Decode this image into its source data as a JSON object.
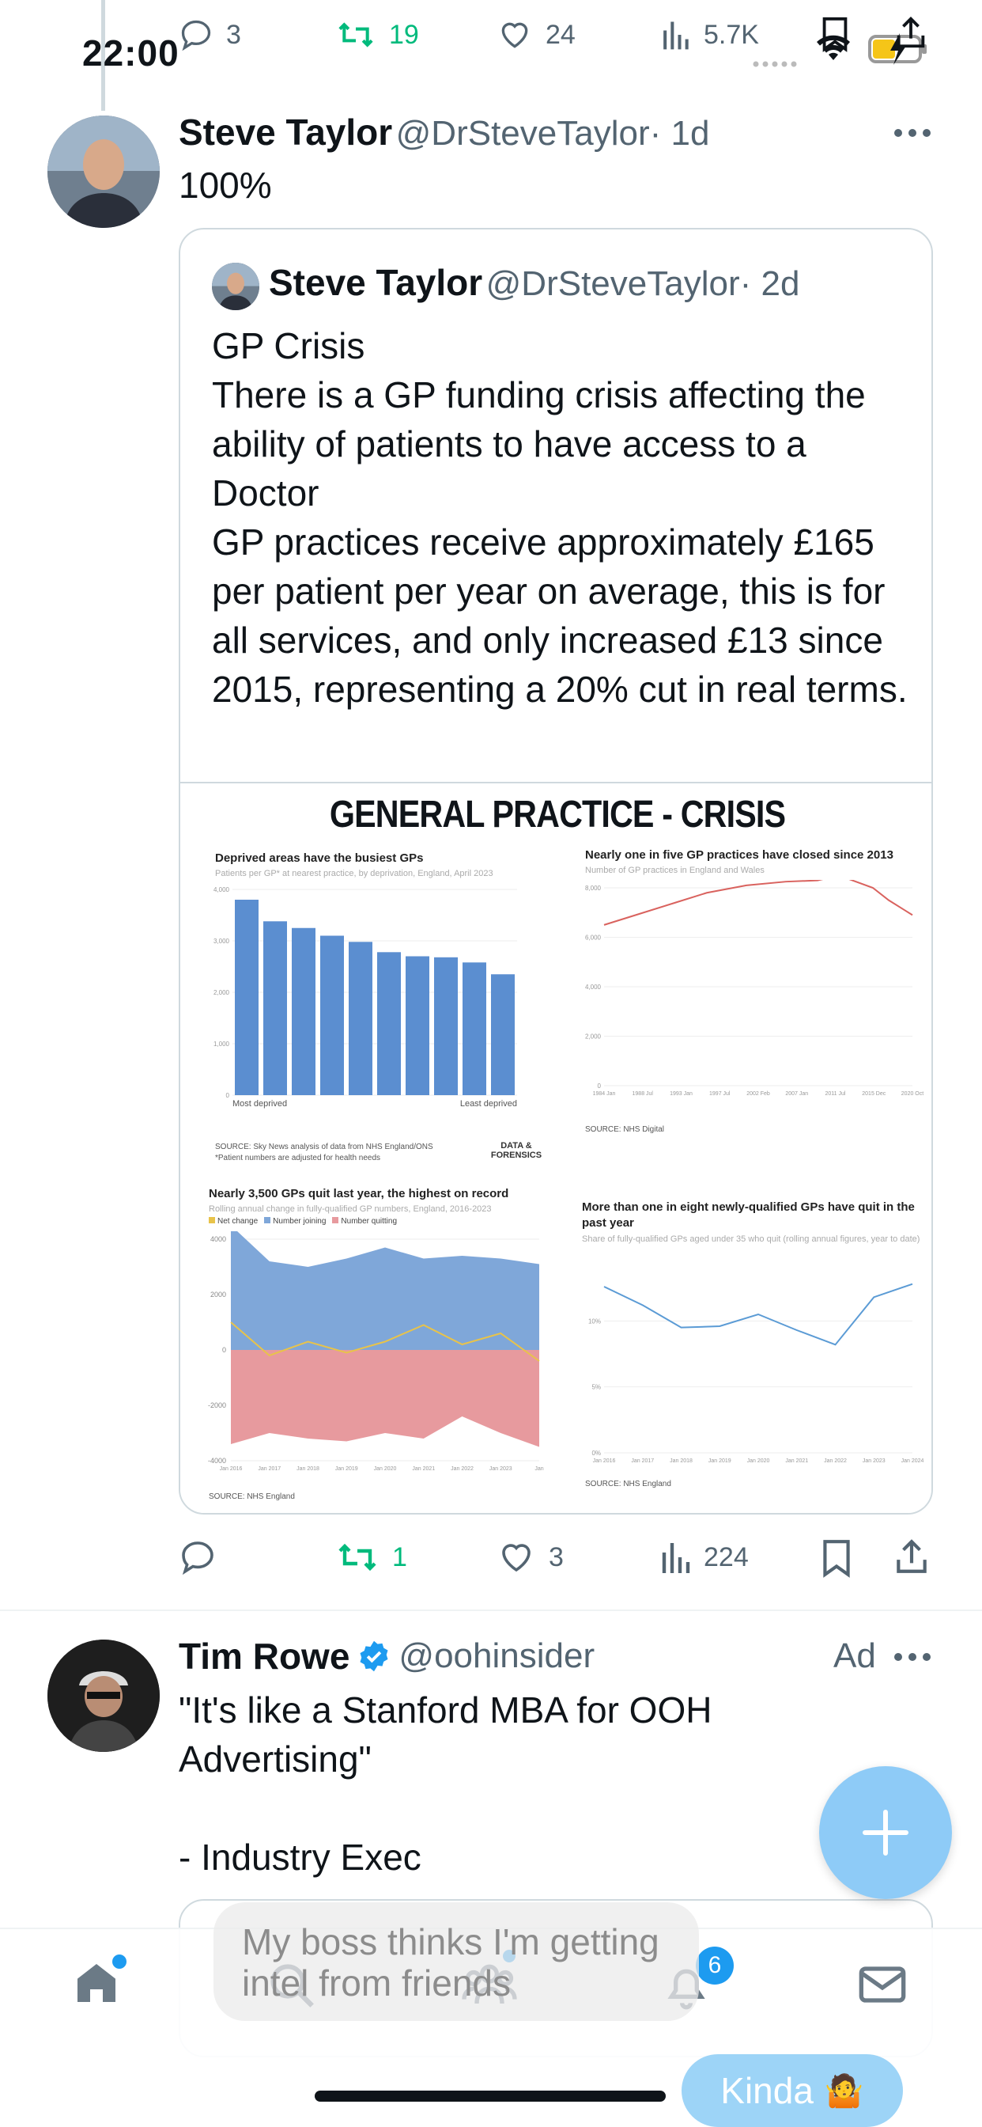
{
  "status_bar": {
    "time": "22:00"
  },
  "top_actions": {
    "replies": "3",
    "retweets": "19",
    "likes": "24",
    "views": "5.7K"
  },
  "tweet": {
    "author_name": "Steve Taylor",
    "author_handle": "@DrSteveTaylor",
    "age": "· 1d",
    "text": "100%",
    "quote": {
      "author_name": "Steve Taylor",
      "author_handle": "@DrSteveTaylor",
      "age": "· 2d",
      "text": "GP Crisis\nThere is a GP funding crisis affecting the ability of patients to have access to a Doctor\nGP practices receive approximately £165 per patient per year on average, this is for all services, and only increased £13 since 2015, representing a 20% cut in real terms."
    },
    "actions": {
      "replies": "",
      "retweets": "1",
      "likes": "3",
      "views": "224"
    }
  },
  "infographic": {
    "title": "GENERAL PRACTICE - CRISIS",
    "brand": "DATA &\nFORENSICS"
  },
  "chart_data": [
    {
      "type": "bar",
      "title": "Deprived areas have the busiest GPs",
      "subtitle": "Patients per GP* at nearest practice, by deprivation, England, April 2023",
      "categories": [
        "Most deprived",
        "",
        "",
        "",
        "",
        "",
        "",
        "",
        "",
        "Least deprived"
      ],
      "values": [
        3800,
        3380,
        3250,
        3100,
        2980,
        2780,
        2700,
        2680,
        2580,
        2350
      ],
      "ylim": [
        0,
        4000
      ],
      "yticks": [
        "0",
        "1,000",
        "2,000",
        "3,000",
        "4,000"
      ],
      "source": "SOURCE: Sky News analysis of data from NHS England/ONS",
      "note": "*Patient numbers are adjusted for health needs",
      "color": "#5b8ed0"
    },
    {
      "type": "line",
      "title": "Nearly one in five GP practices have closed since 2013",
      "subtitle": "Number of GP practices in England and Wales",
      "x": [
        1984,
        1988,
        1993,
        1997,
        2002,
        2007,
        2011,
        2013,
        2015,
        2018,
        2020,
        2023
      ],
      "values": [
        6500,
        6900,
        7400,
        7800,
        8100,
        8250,
        8300,
        8450,
        8350,
        8000,
        7500,
        6900
      ],
      "xticks": [
        "1984 Jan",
        "1988 Jul",
        "1993 Jan",
        "1997 Jul",
        "2002 Feb",
        "2007 Jan",
        "2011 Jul",
        "2015 Dec",
        "2020 Oct"
      ],
      "ylim": [
        0,
        8000
      ],
      "yticks": [
        "0",
        "2,000",
        "4,000",
        "6,000",
        "8,000"
      ],
      "source": "SOURCE: NHS Digital",
      "color": "#d9625e"
    },
    {
      "type": "area",
      "title": "Nearly 3,500 GPs quit last year, the highest on record",
      "subtitle": "Rolling annual change in fully-qualified GP numbers, England, 2016-2023",
      "legend": [
        "Net change",
        "Number joining",
        "Number quitting"
      ],
      "x": [
        "Jan 2016",
        "Jan 2017",
        "Jan 2018",
        "Jan 2019",
        "Jan 2020",
        "Jan 2021",
        "Jan 2022",
        "Jan 2023",
        "Jan"
      ],
      "series": [
        {
          "name": "Number joining",
          "values": [
            4500,
            3200,
            3000,
            3300,
            3700,
            3300,
            3400,
            3300,
            3100
          ],
          "color": "#7fa7d9"
        },
        {
          "name": "Number quitting",
          "values": [
            -3400,
            -3000,
            -3200,
            -3300,
            -3000,
            -3200,
            -2400,
            -3000,
            -3500
          ],
          "color": "#e79a9e"
        },
        {
          "name": "Net change",
          "values": [
            1000,
            -200,
            300,
            -100,
            300,
            900,
            200,
            600,
            -400
          ],
          "color": "#e8c34a"
        }
      ],
      "ylim": [
        -4000,
        4000
      ],
      "yticks": [
        "-4000",
        "-2000",
        "0",
        "2000",
        "4000"
      ],
      "source": "SOURCE: NHS England"
    },
    {
      "type": "line",
      "title": "More than one in eight newly-qualified GPs have quit in the past year",
      "subtitle": "Share of fully-qualified GPs aged under 35 who quit (rolling annual figures, year to date)",
      "x": [
        "Jan 2016",
        "Jan 2017",
        "Jan 2018",
        "Jan 2019",
        "Jan 2020",
        "Jan 2021",
        "Jan 2022",
        "Jan 2023",
        "Jan 2024"
      ],
      "values": [
        12.6,
        11.2,
        9.5,
        9.6,
        10.5,
        9.3,
        8.2,
        11.8,
        12.8
      ],
      "ylim": [
        0,
        15
      ],
      "yticks": [
        "0%",
        "5%",
        "10%"
      ],
      "source": "SOURCE: NHS England",
      "color": "#5b9bd5"
    }
  ],
  "ad": {
    "author_name": "Tim Rowe",
    "author_handle": "@oohinsider",
    "label": "Ad",
    "text": "\"It's like a Stanford MBA for OOH Advertising\"\n\n- Industry Exec"
  },
  "toast": {
    "text": "My boss thinks I'm getting intel from friends",
    "reply": "Kinda"
  },
  "nav": {
    "notifications_badge": "6"
  },
  "colors": {
    "accent": "#1d9bf0",
    "retweet": "#00ba7c",
    "fab": "#8ecbf7"
  }
}
